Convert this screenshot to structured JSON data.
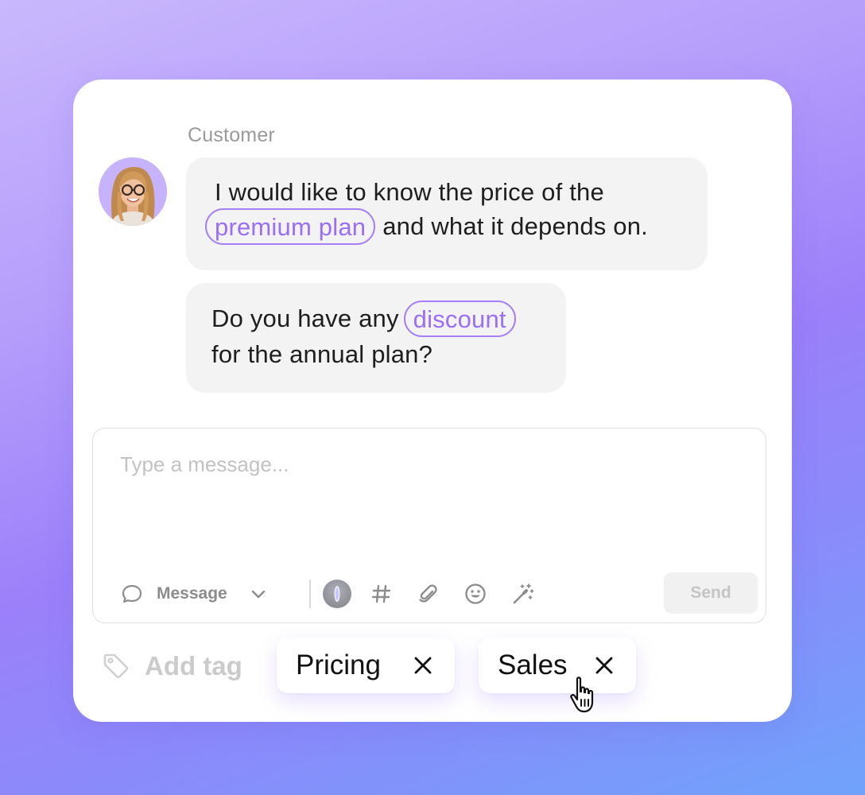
{
  "conversation": {
    "sender_label": "Customer",
    "messages": [
      {
        "line1": "I would like to know the price of the",
        "highlight": "premium plan",
        "line2_rest": "and what it depends on."
      },
      {
        "line1_prefix": "Do you have any",
        "highlight": "discount",
        "line2": "for the annual plan?"
      }
    ]
  },
  "composer": {
    "placeholder": "Type a message...",
    "mode_label": "Message",
    "send_label": "Send",
    "toolbar_icons": [
      "chat-bubble-icon",
      "chevron-down-icon",
      "ai-orb-icon",
      "hash-icon",
      "paperclip-icon",
      "emoji-icon",
      "magic-wand-icon"
    ]
  },
  "tags": {
    "add_label": "Add tag",
    "items": [
      {
        "label": "Pricing"
      },
      {
        "label": "Sales"
      }
    ]
  },
  "colors": {
    "highlight": "#9a6ef6",
    "avatar_bg": "#c7b3fb",
    "bubble_bg": "#f3f3f3"
  }
}
